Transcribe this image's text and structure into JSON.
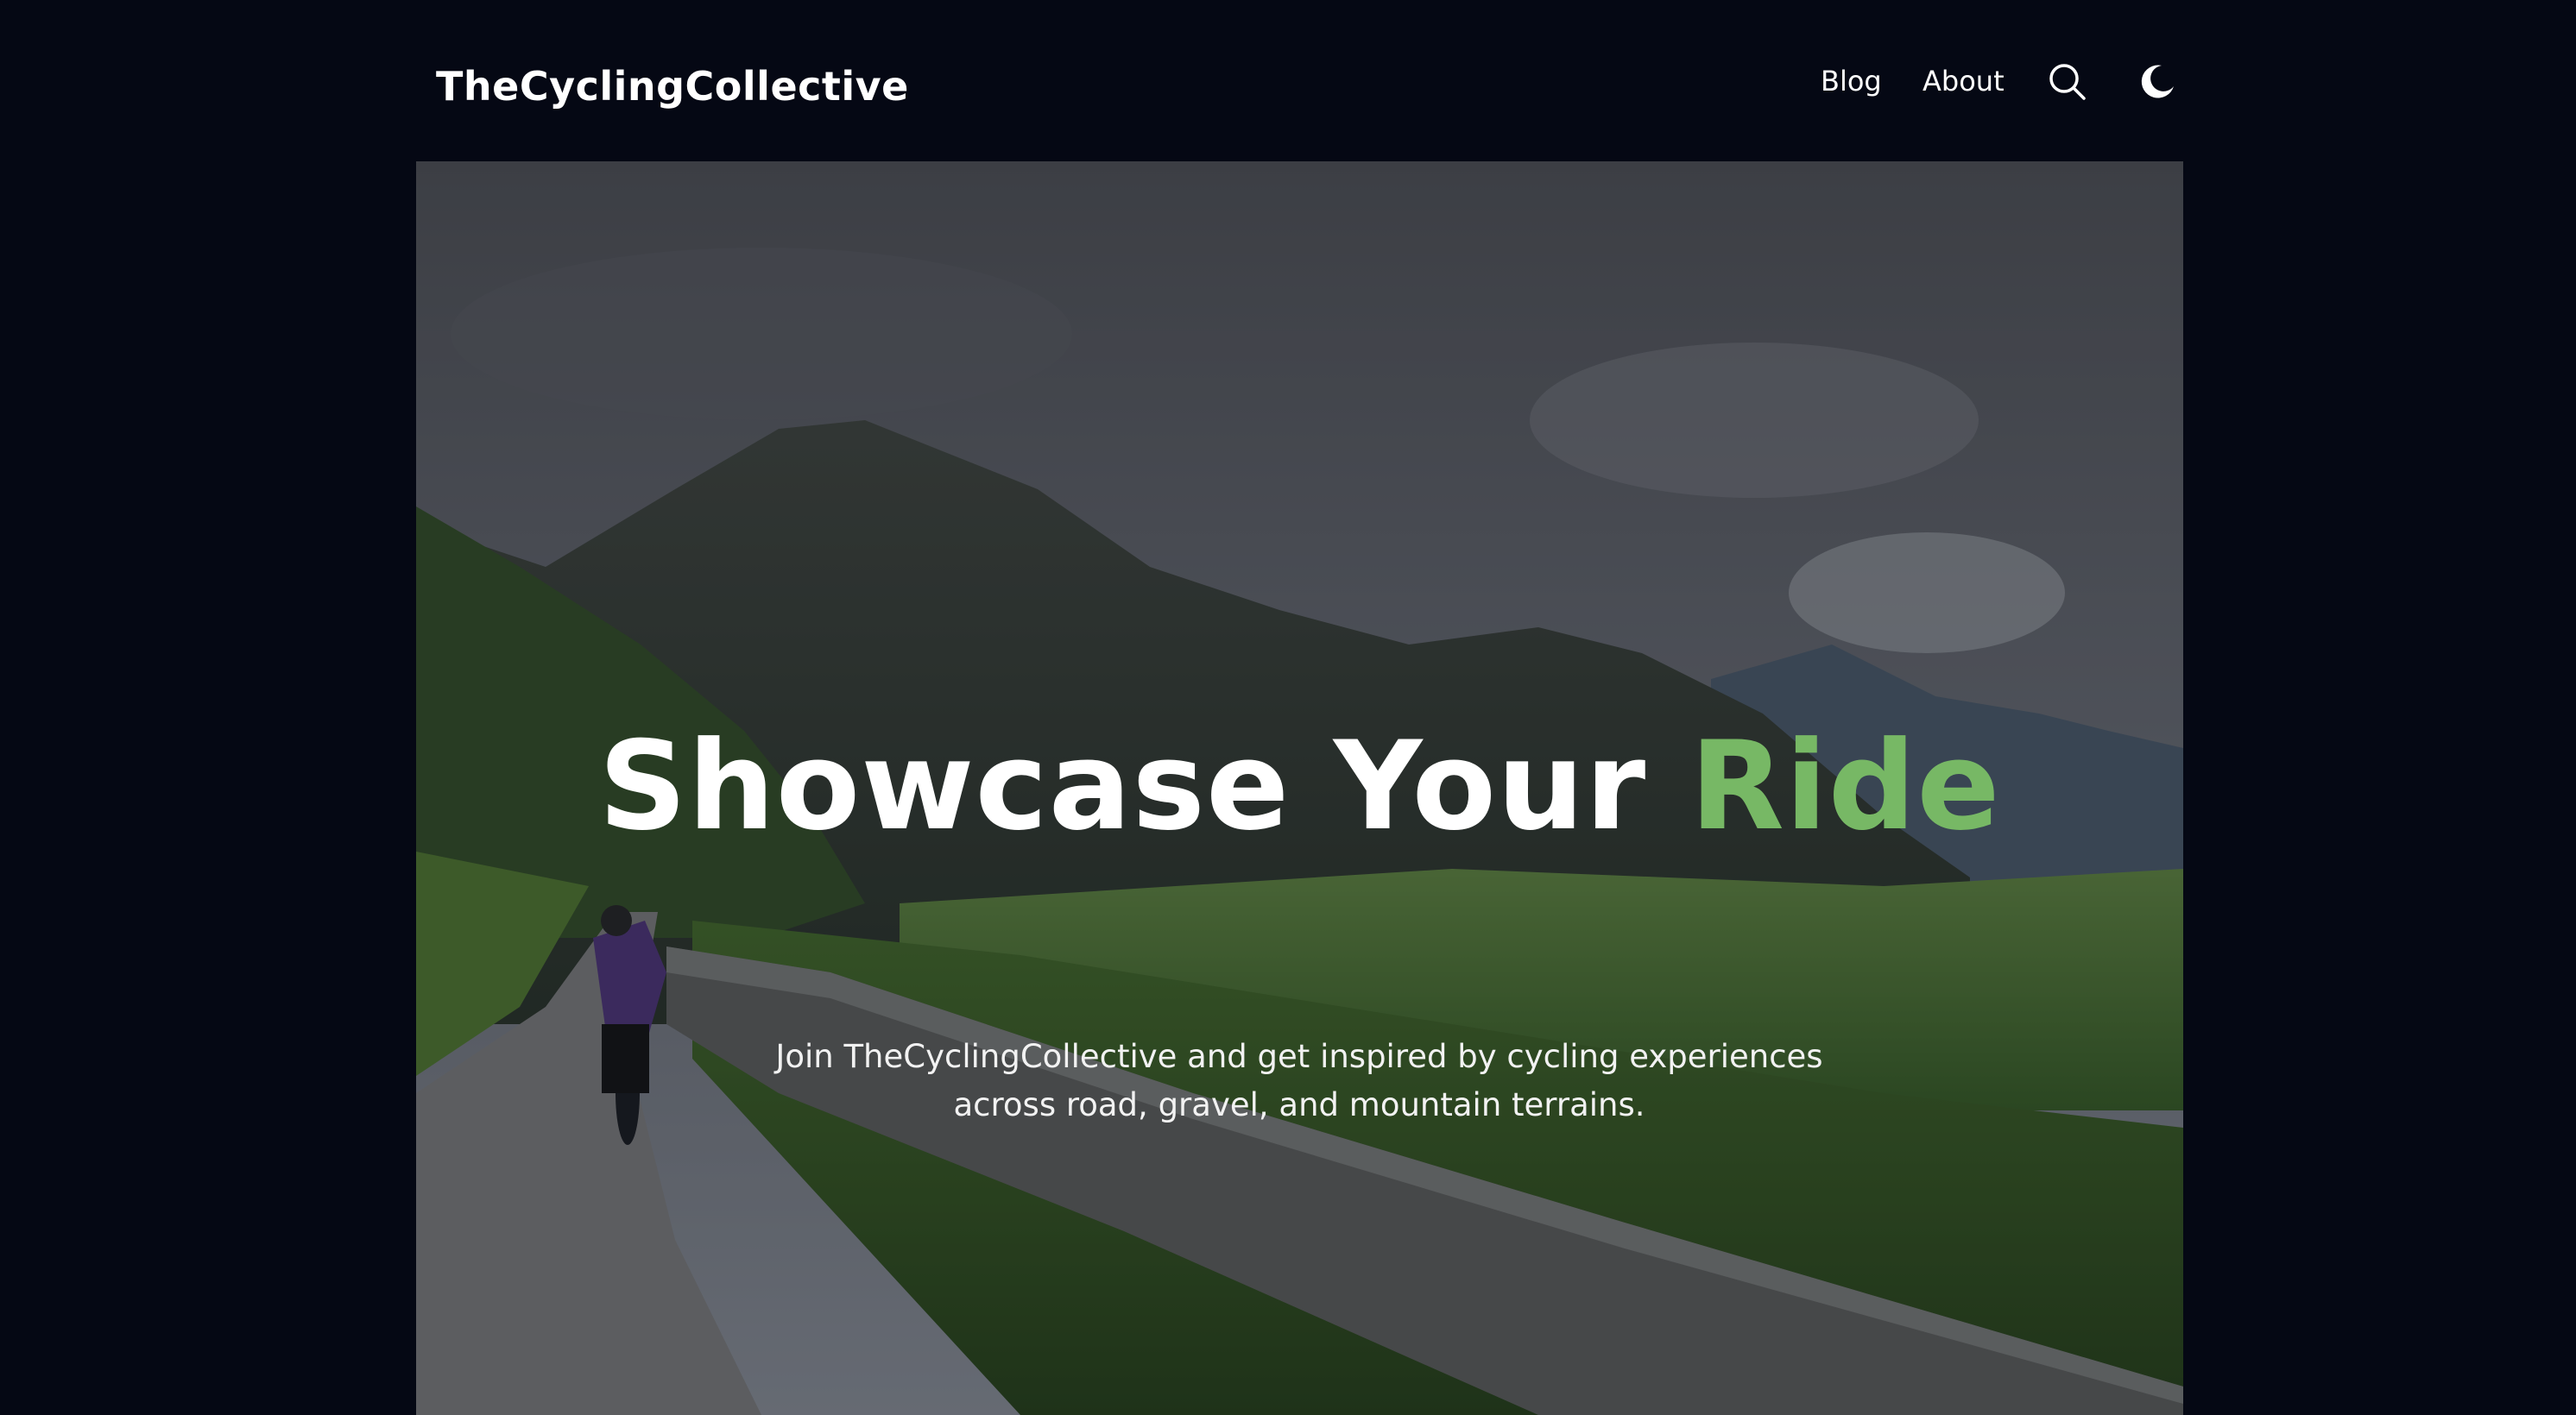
{
  "header": {
    "logo": "TheCyclingCollective",
    "nav": {
      "blog": "Blog",
      "about": "About"
    },
    "icons": {
      "search": "search-icon",
      "theme": "moon-icon"
    }
  },
  "hero": {
    "title_main": "Showcase Your",
    "title_accent": "Ride",
    "subtitle": "Join TheCyclingCollective and get inspired by cycling experiences across road, gravel, and mountain terrains.",
    "image": "cyclist-riding-mountain-valley-road-photo"
  },
  "colors": {
    "background": "#050814",
    "accent": "#77b865",
    "text": "#ffffff"
  }
}
